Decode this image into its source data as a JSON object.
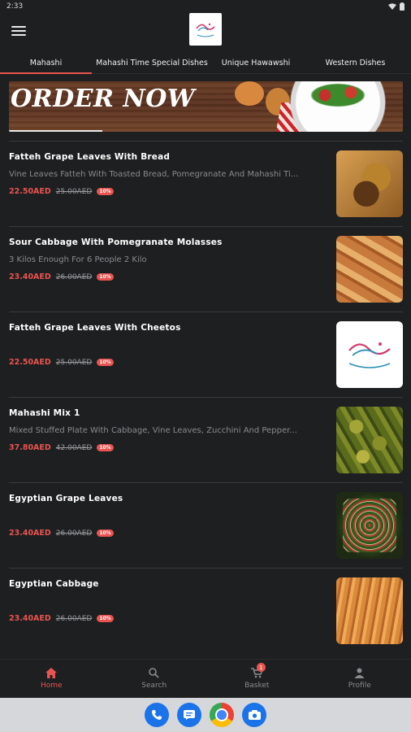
{
  "status": {
    "time": "2:33"
  },
  "header": {
    "logo_alt": "Mahashi Time"
  },
  "tabs": [
    {
      "label": "Mahashi",
      "active": true
    },
    {
      "label": "Mahashi Time Special Dishes",
      "active": false
    },
    {
      "label": "Unique Hawawshi",
      "active": false
    },
    {
      "label": "Western Dishes",
      "active": false
    }
  ],
  "banner": {
    "title": "ORDER NOW"
  },
  "items": [
    {
      "name": "Fatteh Grape Leaves With Bread",
      "desc": "Vine Leaves Fatteh With Toasted Bread, Pomegranate And Mahashi Ti...",
      "price": "22.50AED",
      "old": "25.00AED",
      "badge": "10%"
    },
    {
      "name": "Sour Cabbage With Pomegranate Molasses",
      "desc": "3 Kilos Enough For 6 People 2 Kilo",
      "price": "23.40AED",
      "old": "26.00AED",
      "badge": "10%"
    },
    {
      "name": "Fatteh Grape Leaves With Cheetos",
      "desc": "",
      "price": "22.50AED",
      "old": "25.00AED",
      "badge": "10%"
    },
    {
      "name": "Mahashi Mix 1",
      "desc": "Mixed Stuffed Plate With Cabbage, Vine Leaves, Zucchini And Pepper...",
      "price": "37.80AED",
      "old": "42.00AED",
      "badge": "10%"
    },
    {
      "name": "Egyptian Grape Leaves",
      "desc": "",
      "price": "23.40AED",
      "old": "26.00AED",
      "badge": "10%"
    },
    {
      "name": "Egyptian Cabbage",
      "desc": "",
      "price": "23.40AED",
      "old": "26.00AED",
      "badge": "10%"
    }
  ],
  "nav": {
    "home": "Home",
    "search": "Search",
    "basket": "Basket",
    "basket_count": "1",
    "profile": "Profile"
  },
  "colors": {
    "accent": "#e8544f",
    "background": "#1e1f21"
  }
}
